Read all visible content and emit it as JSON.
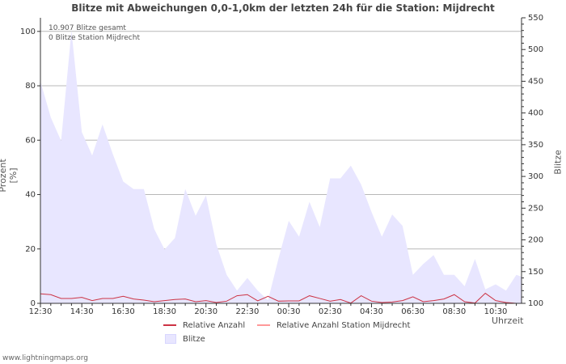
{
  "footer": "www.lightningmaps.org",
  "colors": {
    "area_fill": "#e8e6ff",
    "relative_line": "#cc3344",
    "station_line": "#ff9999",
    "grid": "#b8b8b8"
  },
  "chart_data": {
    "type": "area",
    "title": "Blitze mit Abweichungen 0,0-1,0km der letzten 24h für die Station: Mijdrecht",
    "stats": [
      "10.907 Blitze gesamt",
      "0 Blitze Station Mijdrecht"
    ],
    "ylabel_left": "Prozent   [%]",
    "ylabel_right": "Blitze",
    "xlabel": "Uhrzeit",
    "y_left_range": [
      0,
      105
    ],
    "y_left_ticks": [
      0,
      20,
      40,
      60,
      80,
      100
    ],
    "y_right_range": [
      100,
      550
    ],
    "y_right_ticks": [
      100,
      150,
      200,
      250,
      300,
      350,
      400,
      450,
      500,
      550
    ],
    "x_tick_labels": [
      "12:30",
      "14:30",
      "16:30",
      "18:30",
      "20:30",
      "22:30",
      "00:30",
      "02:30",
      "04:30",
      "06:30",
      "08:30",
      "10:30"
    ],
    "x_range": [
      0,
      46.5
    ],
    "x_tick_positions": [
      0,
      4,
      8,
      12,
      16,
      20,
      24,
      28,
      32,
      36,
      40,
      44
    ],
    "grid": true,
    "legend_position": "bottom",
    "series": [
      {
        "name": "Blitze",
        "axis": "right",
        "kind": "area",
        "x": [
          0,
          1,
          2,
          3,
          4,
          5,
          6,
          7,
          8,
          9,
          10,
          11,
          12,
          13,
          14,
          15,
          16,
          17,
          18,
          19,
          20,
          21,
          22,
          23,
          24,
          25,
          26,
          27,
          28,
          29,
          30,
          31,
          32,
          33,
          34,
          35,
          36,
          37,
          38,
          39,
          40,
          41,
          42,
          43,
          44,
          45,
          46,
          46.5
        ],
        "values": [
          450,
          393,
          356,
          530,
          370,
          333,
          382,
          335,
          292,
          280,
          280,
          217,
          185,
          203,
          280,
          238,
          270,
          193,
          145,
          120,
          140,
          120,
          105,
          170,
          230,
          205,
          260,
          220,
          297,
          297,
          317,
          287,
          244,
          205,
          240,
          222,
          145,
          162,
          176,
          145,
          145,
          127,
          170,
          122,
          130,
          120,
          145,
          142
        ]
      },
      {
        "name": "Relative Anzahl",
        "axis": "left",
        "kind": "line",
        "x": [
          0,
          1,
          2,
          3,
          4,
          5,
          6,
          7,
          8,
          9,
          10,
          11,
          12,
          13,
          14,
          15,
          16,
          17,
          18,
          19,
          20,
          21,
          22,
          23,
          24,
          25,
          26,
          27,
          28,
          29,
          30,
          31,
          32,
          33,
          34,
          35,
          36,
          37,
          38,
          39,
          40,
          41,
          42,
          43,
          44,
          45,
          46,
          46.5
        ],
        "values": [
          3.5,
          3.2,
          1.8,
          1.8,
          2.2,
          1.0,
          1.8,
          1.8,
          2.6,
          1.6,
          1.2,
          0.6,
          1.0,
          1.4,
          1.6,
          0.6,
          1.0,
          0.3,
          0.8,
          2.8,
          3.2,
          0.9,
          2.6,
          0.8,
          0.9,
          0.9,
          2.8,
          1.8,
          0.8,
          1.4,
          0.1,
          2.8,
          0.8,
          0.3,
          0.5,
          1.0,
          2.4,
          0.6,
          1.0,
          1.6,
          3.2,
          0.6,
          0.1,
          3.7,
          1.0,
          0.3,
          0.0,
          0.0
        ]
      },
      {
        "name": "Relative Anzahl Station Mijdrecht",
        "axis": "left",
        "kind": "line",
        "x": [
          0,
          46.5
        ],
        "values": [
          0,
          0
        ]
      }
    ]
  }
}
